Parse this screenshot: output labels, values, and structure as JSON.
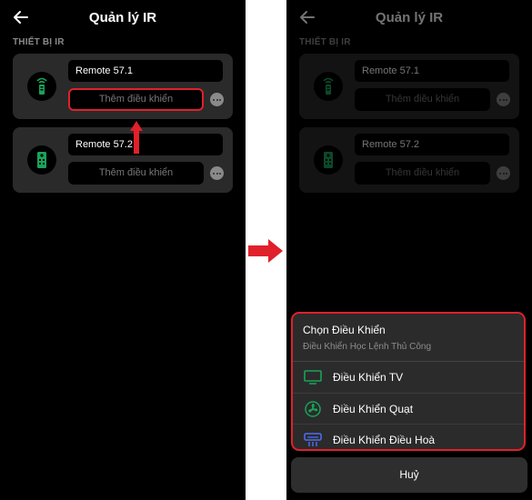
{
  "header": {
    "title": "Quản lý IR"
  },
  "section_label": "THIẾT BỊ IR",
  "devices": [
    {
      "name": "Remote 57.1",
      "add_label": "Thêm điều khiển"
    },
    {
      "name": "Remote 57.2",
      "add_label": "Thêm điều khiển"
    }
  ],
  "sheet": {
    "title": "Chọn Điều Khiển",
    "subtitle": "Điều Khiển Học Lệnh Thủ Công",
    "options": [
      {
        "label": "Điều Khiển TV",
        "icon": "tv-icon",
        "color": "#19a35a"
      },
      {
        "label": "Điều Khiển Quạt",
        "icon": "fan-icon",
        "color": "#19a35a"
      },
      {
        "label": "Điều Khiển Điều Hoà",
        "icon": "air-conditioner-icon",
        "color": "#4c6ef5"
      }
    ],
    "cancel_label": "Huỷ"
  },
  "colors": {
    "highlight": "#e0202a",
    "accent_green": "#19a35a"
  }
}
